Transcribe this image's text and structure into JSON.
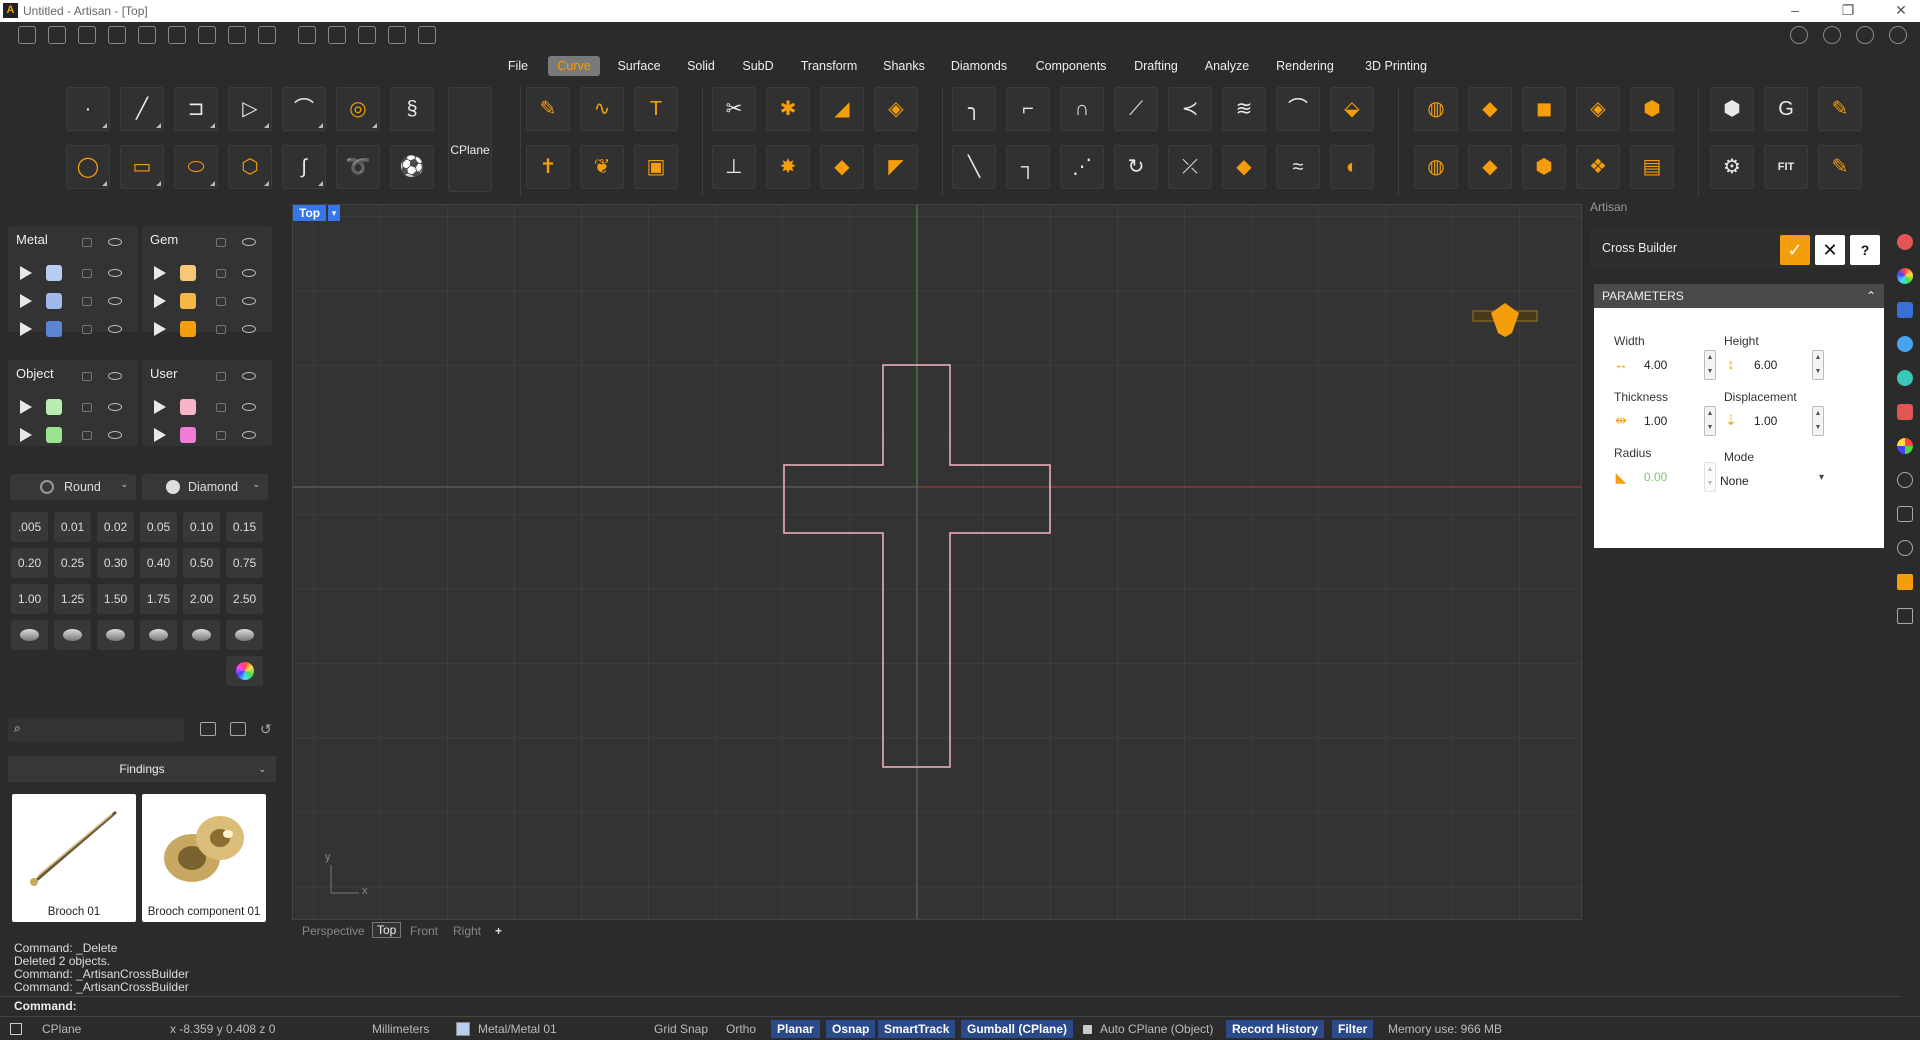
{
  "window": {
    "title": "Untitled - Artisan - [Top]"
  },
  "menu": {
    "items": [
      "File",
      "Curve",
      "Surface",
      "Solid",
      "SubD",
      "Transform",
      "Shanks",
      "Diamonds",
      "Components",
      "Drafting",
      "Analyze",
      "Rendering",
      "3D Printing"
    ],
    "active": "Curve"
  },
  "ribbon": {
    "cplane_label": "CPlane"
  },
  "layers": {
    "metal": {
      "title": "Metal",
      "swatches": [
        "#b9ccf2",
        "#9fb9ec",
        "#5c85d6"
      ]
    },
    "gem": {
      "title": "Gem",
      "swatches": [
        "#f7c87a",
        "#f5b847",
        "#f59e0b"
      ]
    },
    "object": {
      "title": "Object",
      "swatches": [
        "#b9ecb0",
        "#9be28f"
      ]
    },
    "user": {
      "title": "User",
      "swatches": [
        "#f7b5c6",
        "#f07cd8"
      ]
    }
  },
  "gem_tools": {
    "shape": "Round",
    "type": "Diamond",
    "sizes": [
      ".005",
      "0.01",
      "0.02",
      "0.05",
      "0.10",
      "0.15",
      "0.20",
      "0.25",
      "0.30",
      "0.40",
      "0.50",
      "0.75",
      "1.00",
      "1.25",
      "1.50",
      "1.75",
      "2.00",
      "2.50"
    ]
  },
  "library": {
    "category": "Findings",
    "items": [
      {
        "label": "Brooch 01"
      },
      {
        "label": "Brooch component 01"
      }
    ]
  },
  "viewport": {
    "name": "Top",
    "axis_y": "y",
    "axis_x": "x",
    "tabs": [
      "Perspective",
      "Top",
      "Front",
      "Right"
    ],
    "active_tab": "Top",
    "add_tab": "+"
  },
  "artisan_panel": {
    "header": "Artisan",
    "command": "Cross Builder",
    "ok": "✓",
    "cancel": "✕",
    "help": "?",
    "params_title": "PARAMETERS",
    "width_label": "Width",
    "width_value": "4.00",
    "height_label": "Height",
    "height_value": "6.00",
    "thickness_label": "Thickness",
    "thickness_value": "1.00",
    "displacement_label": "Displacement",
    "displacement_value": "1.00",
    "radius_label": "Radius",
    "radius_value": "0.00",
    "mode_label": "Mode",
    "mode_value": "None"
  },
  "command_history": [
    "Command: _Delete",
    "Deleted 2 objects.",
    "Command: _ArtisanCrossBuilder",
    "Command: _ArtisanCrossBuilder"
  ],
  "command_prompt": "Command:",
  "status": {
    "cplane": "CPlane",
    "coords": "x -8.359  y 0.408  z 0",
    "units": "Millimeters",
    "layer": "Metal/Metal 01",
    "grid_snap": "Grid Snap",
    "ortho": "Ortho",
    "planar": "Planar",
    "osnap": "Osnap",
    "smarttrack": "SmartTrack",
    "gumball": "Gumball (CPlane)",
    "auto_cplane": "Auto CPlane (Object)",
    "record_history": "Record History",
    "filter": "Filter",
    "memory": "Memory use: 966 MB"
  },
  "colors": {
    "accent": "#f59e0b",
    "active_toggle": "#2a4a8a",
    "curve": "#f4b6bf"
  }
}
